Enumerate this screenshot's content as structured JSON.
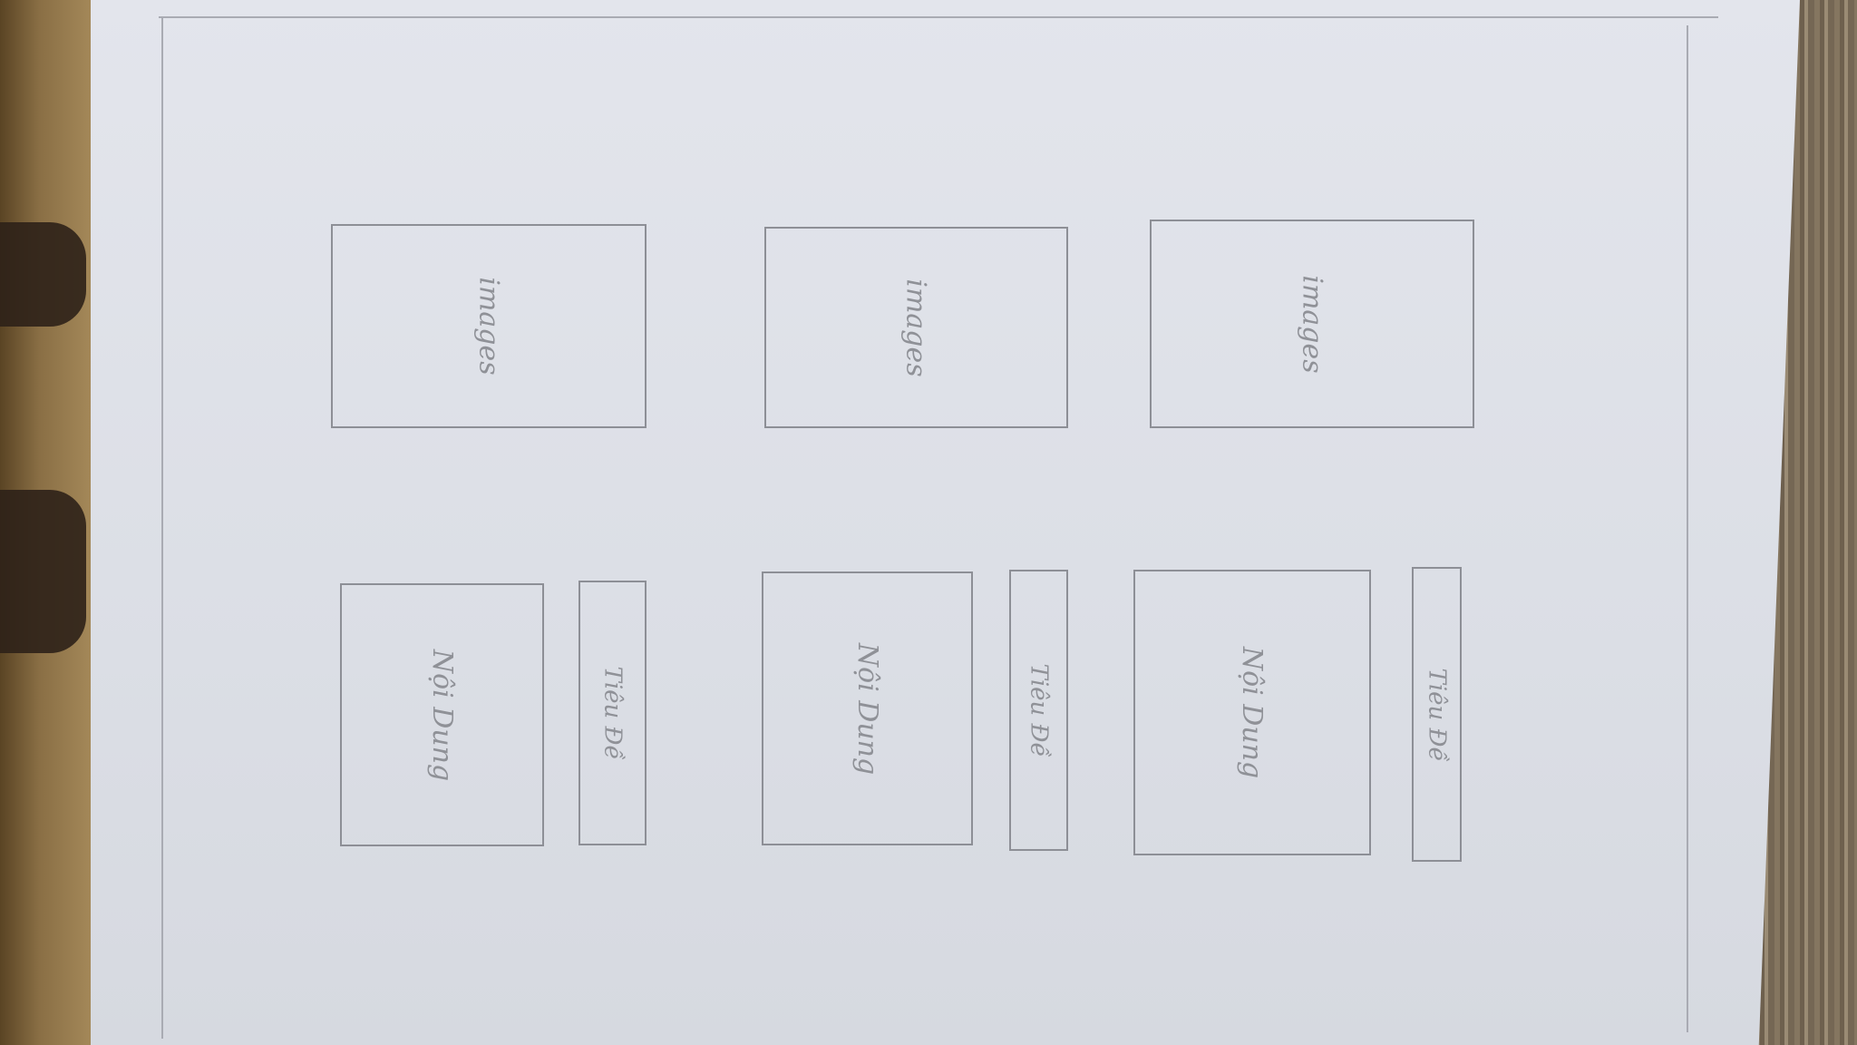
{
  "sketch": {
    "columns": [
      {
        "image_label": "images",
        "content_label": "Nội Dung",
        "title_label": "Tiêu Đề"
      },
      {
        "image_label": "images",
        "content_label": "Nội Dung",
        "title_label": "Tiêu Đề"
      },
      {
        "image_label": "images",
        "content_label": "Nội Dung",
        "title_label": "Tiêu Đề"
      }
    ]
  }
}
